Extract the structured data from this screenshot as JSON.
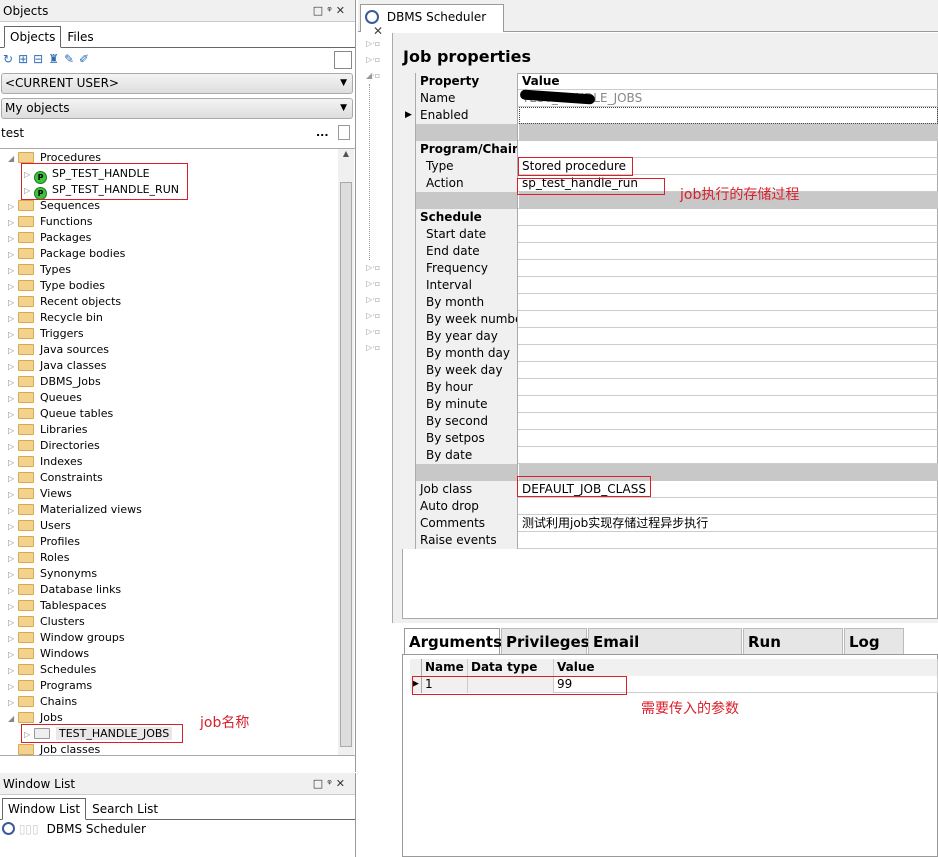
{
  "objects_panel": {
    "title": "Objects",
    "tabs": [
      "Objects",
      "Files"
    ],
    "owner_combo": "<CURRENT USER>",
    "filter_combo": "My objects",
    "search_value": "test",
    "search_more": "...",
    "tree": [
      {
        "label": "Procedures",
        "level": 0,
        "kind": "folder",
        "expanded": true
      },
      {
        "label": "SP_TEST_HANDLE",
        "level": 1,
        "kind": "procedure"
      },
      {
        "label": "SP_TEST_HANDLE_RUN",
        "level": 1,
        "kind": "procedure"
      },
      {
        "label": "Sequences",
        "level": 0,
        "kind": "folder"
      },
      {
        "label": "Functions",
        "level": 0,
        "kind": "folder"
      },
      {
        "label": "Packages",
        "level": 0,
        "kind": "folder"
      },
      {
        "label": "Package bodies",
        "level": 0,
        "kind": "folder"
      },
      {
        "label": "Types",
        "level": 0,
        "kind": "folder"
      },
      {
        "label": "Type bodies",
        "level": 0,
        "kind": "folder"
      },
      {
        "label": "Recent objects",
        "level": 0,
        "kind": "folder"
      },
      {
        "label": "Recycle bin",
        "level": 0,
        "kind": "folder"
      },
      {
        "label": "Triggers",
        "level": 0,
        "kind": "folder"
      },
      {
        "label": "Java sources",
        "level": 0,
        "kind": "folder"
      },
      {
        "label": "Java classes",
        "level": 0,
        "kind": "folder"
      },
      {
        "label": "DBMS_Jobs",
        "level": 0,
        "kind": "folder"
      },
      {
        "label": "Queues",
        "level": 0,
        "kind": "folder"
      },
      {
        "label": "Queue tables",
        "level": 0,
        "kind": "folder"
      },
      {
        "label": "Libraries",
        "level": 0,
        "kind": "folder"
      },
      {
        "label": "Directories",
        "level": 0,
        "kind": "folder"
      },
      {
        "label": "Indexes",
        "level": 0,
        "kind": "folder"
      },
      {
        "label": "Constraints",
        "level": 0,
        "kind": "folder"
      },
      {
        "label": "Views",
        "level": 0,
        "kind": "folder"
      },
      {
        "label": "Materialized views",
        "level": 0,
        "kind": "folder"
      },
      {
        "label": "Users",
        "level": 0,
        "kind": "folder"
      },
      {
        "label": "Profiles",
        "level": 0,
        "kind": "folder"
      },
      {
        "label": "Roles",
        "level": 0,
        "kind": "folder"
      },
      {
        "label": "Synonyms",
        "level": 0,
        "kind": "folder"
      },
      {
        "label": "Database links",
        "level": 0,
        "kind": "folder"
      },
      {
        "label": "Tablespaces",
        "level": 0,
        "kind": "folder"
      },
      {
        "label": "Clusters",
        "level": 0,
        "kind": "folder"
      },
      {
        "label": "Window groups",
        "level": 0,
        "kind": "folder"
      },
      {
        "label": "Windows",
        "level": 0,
        "kind": "folder"
      },
      {
        "label": "Schedules",
        "level": 0,
        "kind": "folder"
      },
      {
        "label": "Programs",
        "level": 0,
        "kind": "folder"
      },
      {
        "label": "Chains",
        "level": 0,
        "kind": "folder"
      },
      {
        "label": "Jobs",
        "level": 0,
        "kind": "folder",
        "expanded": true
      },
      {
        "label": "TEST_HANDLE_JOBS",
        "level": 1,
        "kind": "job"
      },
      {
        "label": "Job classes",
        "level": 0,
        "kind": "folder",
        "last": true
      }
    ],
    "note_job_name": "job名称"
  },
  "window_list": {
    "title": "Window List",
    "tabs": [
      "Window List",
      "Search List"
    ],
    "items": [
      "DBMS Scheduler"
    ]
  },
  "editor": {
    "tab_title": "DBMS Scheduler",
    "heading": "Job properties",
    "grid_header": {
      "property": "Property",
      "value": "Value"
    },
    "rows": [
      {
        "type": "row",
        "prop": "Name",
        "value": "TEST_HANDLE_JOBS",
        "muted": true
      },
      {
        "type": "row",
        "prop": "Enabled",
        "value": "",
        "current": true
      },
      {
        "type": "sep"
      },
      {
        "type": "sec",
        "prop": "Program/Chain"
      },
      {
        "type": "sub",
        "prop": "Type",
        "value": "Stored procedure"
      },
      {
        "type": "sub",
        "prop": "Action",
        "value": "sp_test_handle_run"
      },
      {
        "type": "sep"
      },
      {
        "type": "sec",
        "prop": "Schedule"
      },
      {
        "type": "sub",
        "prop": "Start date",
        "value": ""
      },
      {
        "type": "sub",
        "prop": "End date",
        "value": ""
      },
      {
        "type": "sub",
        "prop": "Frequency",
        "value": ""
      },
      {
        "type": "sub",
        "prop": "Interval",
        "value": ""
      },
      {
        "type": "sub",
        "prop": "By month",
        "value": ""
      },
      {
        "type": "sub",
        "prop": "By week number",
        "value": ""
      },
      {
        "type": "sub",
        "prop": "By year day",
        "value": ""
      },
      {
        "type": "sub",
        "prop": "By month day",
        "value": ""
      },
      {
        "type": "sub",
        "prop": "By week day",
        "value": ""
      },
      {
        "type": "sub",
        "prop": "By hour",
        "value": ""
      },
      {
        "type": "sub",
        "prop": "By minute",
        "value": ""
      },
      {
        "type": "sub",
        "prop": "By second",
        "value": ""
      },
      {
        "type": "sub",
        "prop": "By setpos",
        "value": ""
      },
      {
        "type": "sub",
        "prop": "By date",
        "value": ""
      },
      {
        "type": "sep"
      },
      {
        "type": "row",
        "prop": "Job class",
        "value": "DEFAULT_JOB_CLASS"
      },
      {
        "type": "row",
        "prop": "Auto drop",
        "value": ""
      },
      {
        "type": "row",
        "prop": "Comments",
        "value": "测试利用job实现存储过程异步执行"
      },
      {
        "type": "row",
        "prop": "Raise events",
        "value": ""
      }
    ],
    "note_action": "job执行的存储过程",
    "bottom_tabs": [
      "Arguments",
      "Privileges",
      "Email notifications",
      "Run details",
      "Log"
    ],
    "args_header": [
      "Name",
      "Data type",
      "Value"
    ],
    "args_rows": [
      [
        "1",
        "",
        "99"
      ]
    ],
    "note_args": "需要传入的参数"
  },
  "colors": {
    "annotation": "#d8202c",
    "separator": "#c8c8c8"
  }
}
